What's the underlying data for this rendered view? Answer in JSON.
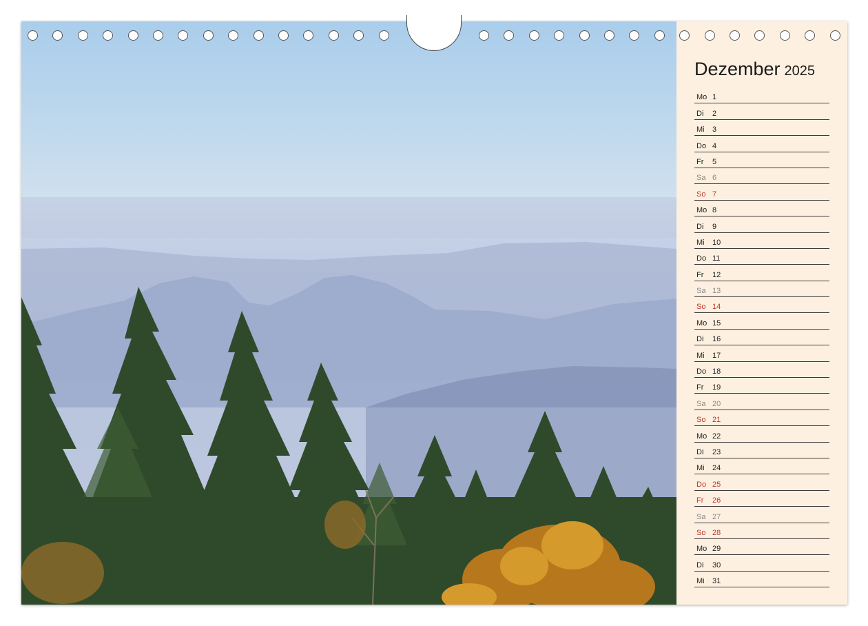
{
  "calendar": {
    "month": "Dezember",
    "year": "2025",
    "days": [
      {
        "dow": "Mo",
        "day": "1",
        "type": "weekday"
      },
      {
        "dow": "Di",
        "day": "2",
        "type": "weekday"
      },
      {
        "dow": "Mi",
        "day": "3",
        "type": "weekday"
      },
      {
        "dow": "Do",
        "day": "4",
        "type": "weekday"
      },
      {
        "dow": "Fr",
        "day": "5",
        "type": "weekday"
      },
      {
        "dow": "Sa",
        "day": "6",
        "type": "saturday"
      },
      {
        "dow": "So",
        "day": "7",
        "type": "sunday"
      },
      {
        "dow": "Mo",
        "day": "8",
        "type": "weekday"
      },
      {
        "dow": "Di",
        "day": "9",
        "type": "weekday"
      },
      {
        "dow": "Mi",
        "day": "10",
        "type": "weekday"
      },
      {
        "dow": "Do",
        "day": "11",
        "type": "weekday"
      },
      {
        "dow": "Fr",
        "day": "12",
        "type": "weekday"
      },
      {
        "dow": "Sa",
        "day": "13",
        "type": "saturday"
      },
      {
        "dow": "So",
        "day": "14",
        "type": "sunday"
      },
      {
        "dow": "Mo",
        "day": "15",
        "type": "weekday"
      },
      {
        "dow": "Di",
        "day": "16",
        "type": "weekday"
      },
      {
        "dow": "Mi",
        "day": "17",
        "type": "weekday"
      },
      {
        "dow": "Do",
        "day": "18",
        "type": "weekday"
      },
      {
        "dow": "Fr",
        "day": "19",
        "type": "weekday"
      },
      {
        "dow": "Sa",
        "day": "20",
        "type": "saturday"
      },
      {
        "dow": "So",
        "day": "21",
        "type": "sunday"
      },
      {
        "dow": "Mo",
        "day": "22",
        "type": "weekday"
      },
      {
        "dow": "Di",
        "day": "23",
        "type": "weekday"
      },
      {
        "dow": "Mi",
        "day": "24",
        "type": "weekday"
      },
      {
        "dow": "Do",
        "day": "25",
        "type": "sunday"
      },
      {
        "dow": "Fr",
        "day": "26",
        "type": "sunday"
      },
      {
        "dow": "Sa",
        "day": "27",
        "type": "saturday"
      },
      {
        "dow": "So",
        "day": "28",
        "type": "sunday"
      },
      {
        "dow": "Mo",
        "day": "29",
        "type": "weekday"
      },
      {
        "dow": "Di",
        "day": "30",
        "type": "weekday"
      },
      {
        "dow": "Mi",
        "day": "31",
        "type": "weekday"
      }
    ]
  },
  "colors": {
    "sunday_holiday": "#c0392b",
    "saturday": "#8a8a8a",
    "panel_background": "#fdf0e0"
  },
  "photo": {
    "subject": "misty-mountains-forest"
  }
}
